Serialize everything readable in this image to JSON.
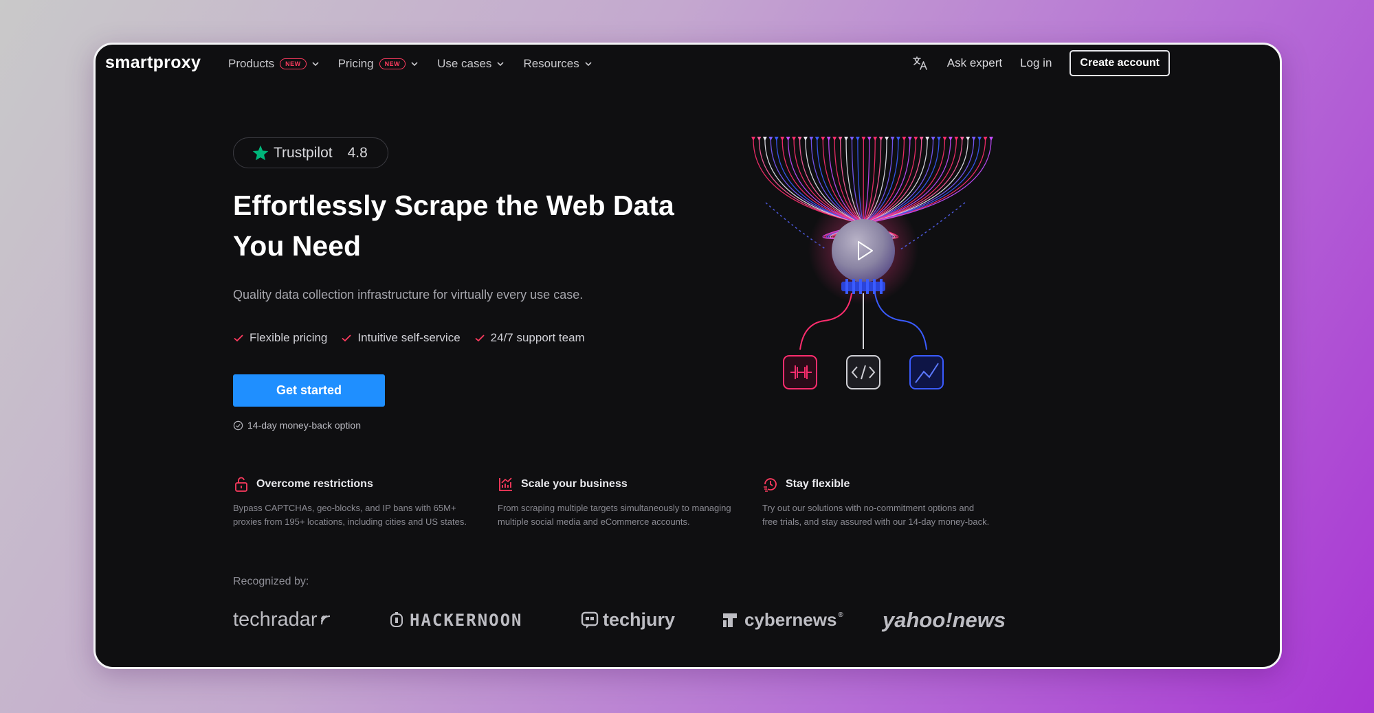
{
  "nav": {
    "logo": "smartproxy",
    "menu": [
      {
        "label": "Products",
        "badge": "NEW"
      },
      {
        "label": "Pricing",
        "badge": "NEW"
      },
      {
        "label": "Use cases",
        "badge": ""
      },
      {
        "label": "Resources",
        "badge": ""
      }
    ],
    "ask_expert": "Ask expert",
    "login": "Log in",
    "create_account": "Create account"
  },
  "hero": {
    "trustpilot_label": "Trustpilot",
    "trustpilot_rating": "4.8",
    "headline_line1": "Effortlessly Scrape the Web Data",
    "headline_line2": "You Need",
    "subheadline": "Quality data collection infrastructure for virtually every use case.",
    "features": [
      "Flexible pricing",
      "Intuitive self-service",
      "24/7 support team"
    ],
    "cta": "Get started",
    "moneyback": "14-day money-back option"
  },
  "benefits": [
    {
      "title": "Overcome restrictions",
      "line1": "Bypass CAPTCHAs, geo-blocks, and IP bans with 65M+",
      "line2": "proxies from 195+ locations, including cities and US states.",
      "icon": "unlock-icon"
    },
    {
      "title": "Scale your business",
      "line1": "From scraping multiple targets simultaneously to managing",
      "line2": "multiple social media and eCommerce accounts.",
      "icon": "chart-icon"
    },
    {
      "title": "Stay flexible",
      "line1": "Try out our solutions with no-commitment options and",
      "line2": "free trials, and stay assured with our 14-day money-back.",
      "icon": "clock-icon"
    }
  ],
  "recognized": {
    "label": "Recognized by:",
    "logos": [
      "techradar",
      "HACKERNOON",
      "techjury",
      "cybernews",
      "yahoo!news"
    ]
  },
  "colors": {
    "accent_blue": "#1f8fff",
    "accent_red": "#ff3b5f",
    "trustpilot_green": "#00b67a",
    "background": "#0f0f11"
  }
}
